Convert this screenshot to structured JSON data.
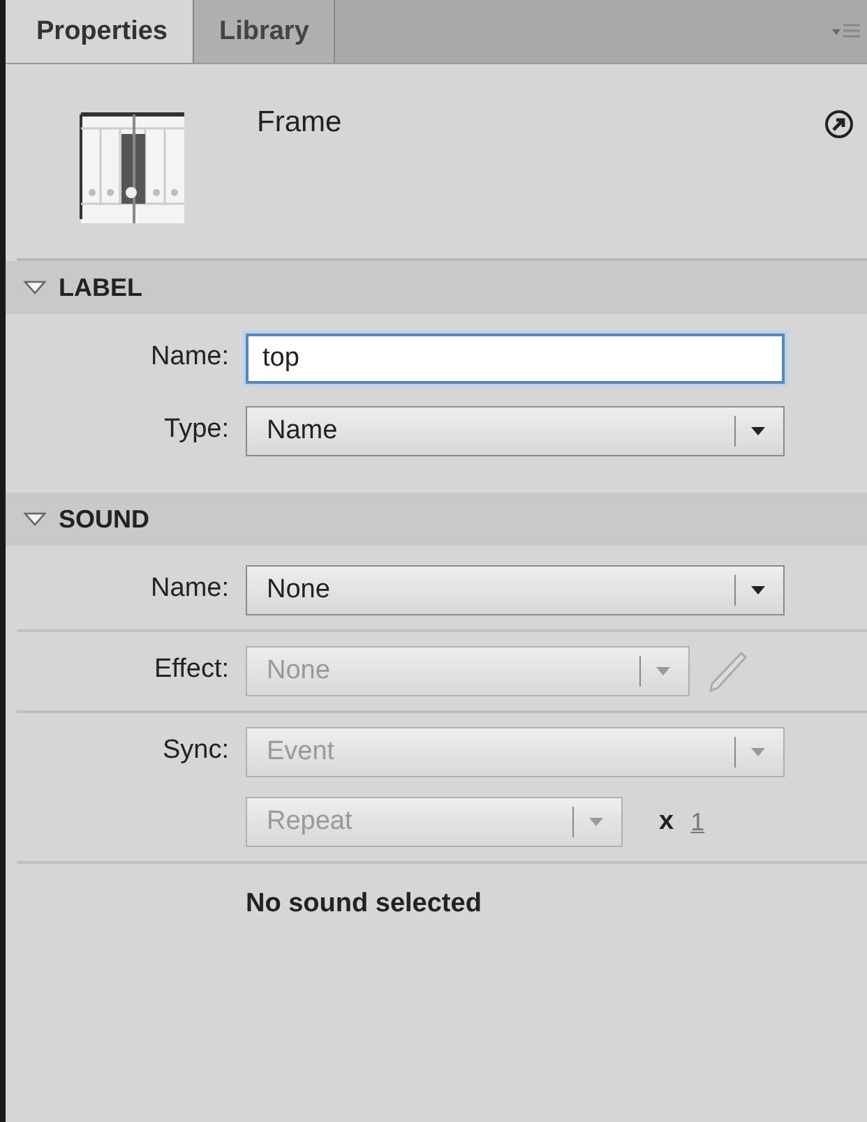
{
  "tabs": [
    {
      "label": "Properties",
      "selected": true
    },
    {
      "label": "Library",
      "selected": false
    }
  ],
  "header": {
    "title": "Frame"
  },
  "sections": [
    {
      "title": "LABEL",
      "expanded": true,
      "rows": [
        {
          "kind": "text",
          "label": "Name:",
          "value": "top",
          "focused": true,
          "divider": false
        },
        {
          "kind": "dropdown",
          "label": "Type:",
          "value": "Name",
          "disabled": false,
          "divider": false
        }
      ]
    },
    {
      "title": "SOUND",
      "expanded": true,
      "rows": [
        {
          "kind": "dropdown",
          "label": "Name:",
          "value": "None",
          "disabled": false,
          "divider": true
        },
        {
          "kind": "effect",
          "label": "Effect:",
          "value": "None",
          "disabled": true,
          "divider": true
        },
        {
          "kind": "sync",
          "label": "Sync:",
          "value": "Event",
          "disabled": true,
          "repeat": {
            "value": "Repeat",
            "disabled": true
          },
          "times": "x",
          "count": "1",
          "divider": true
        },
        {
          "kind": "message",
          "text": "No sound selected",
          "divider": false
        }
      ]
    }
  ]
}
